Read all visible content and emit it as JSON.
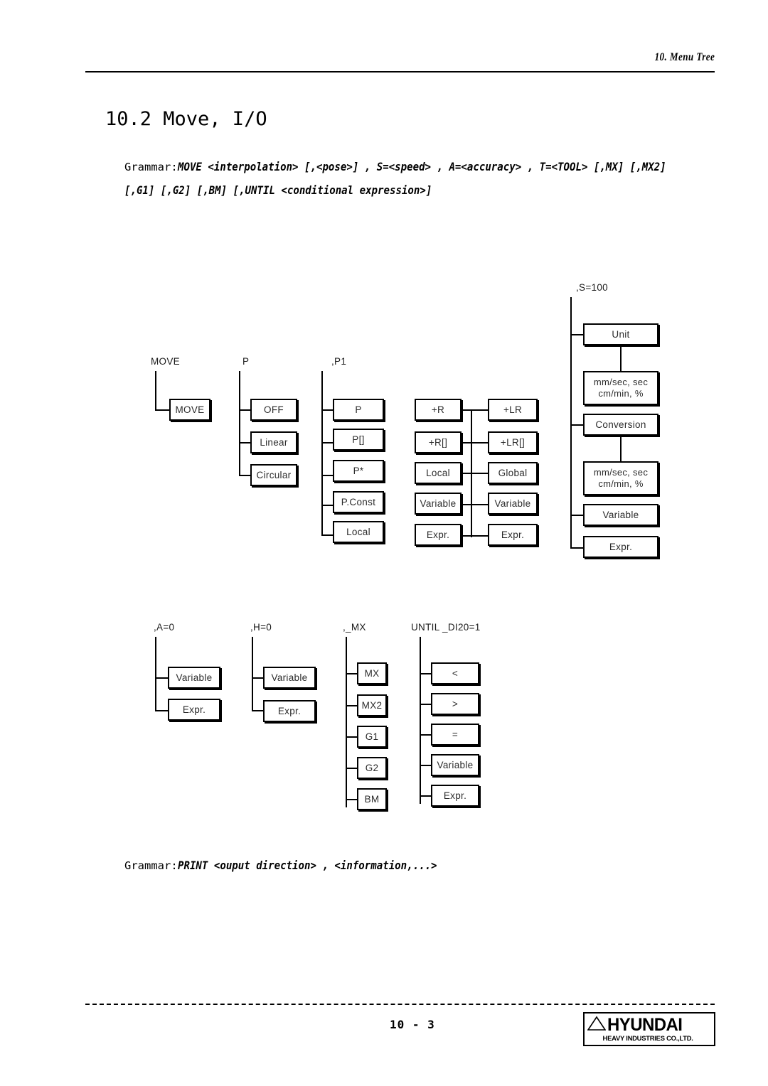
{
  "header": {
    "chapter": "10. Menu Tree"
  },
  "section": {
    "title": "10.2 Move, I/O"
  },
  "grammar_move": {
    "label": "Grammar:",
    "line1": "MOVE <interpolation> [,<pose>] , S=<speed> , A=<accuracy> , T=<TOOL> [,MX] [,MX2]",
    "line2": "[,G1] [,G2] [,BM] [,UNTIL <conditional expression>]"
  },
  "grammar_print": {
    "label": "Grammar:",
    "line1": "PRINT <ouput direction> , <information,...>"
  },
  "tree_upper": {
    "col_move": {
      "label": "MOVE",
      "nodes": [
        "MOVE"
      ]
    },
    "col_interpolation": {
      "label": "P",
      "nodes": [
        "OFF",
        "Linear",
        "Circular"
      ]
    },
    "col_pose": {
      "label": ",P1",
      "nodes": [
        "P",
        "P[]",
        "P*",
        "P.Const",
        "Local"
      ]
    },
    "col_r": {
      "nodes": [
        "+R",
        "+R[]",
        "Local",
        "Variable",
        "Expr."
      ]
    },
    "col_lr": {
      "nodes": [
        "+LR",
        "+LR[]",
        "Global",
        "Variable",
        "Expr."
      ]
    },
    "col_speed": {
      "label": ",S=100",
      "nodes": [
        "Unit",
        "Conversion",
        "Variable",
        "Expr."
      ],
      "unit_sub_line1": "mm/sec, sec",
      "unit_sub_line2": "cm/min, %",
      "conversion_sub_line1": "mm/sec, sec",
      "conversion_sub_line2": "cm/min, %"
    }
  },
  "tree_lower": {
    "col_accuracy": {
      "label": ",A=0",
      "nodes": [
        "Variable",
        "Expr."
      ]
    },
    "col_tool": {
      "label": ",H=0",
      "nodes": [
        "Variable",
        "Expr."
      ]
    },
    "col_mx": {
      "label": ",_MX",
      "nodes": [
        "MX",
        "MX2",
        "G1",
        "G2",
        "BM"
      ]
    },
    "col_until": {
      "label": "UNTIL _DI20=1",
      "nodes": [
        "<",
        ">",
        "=",
        "Variable",
        "Expr."
      ]
    }
  },
  "footer": {
    "page_number": "10 - 3",
    "logo_word": "HYUNDAI",
    "logo_sub": "HEAVY INDUSTRIES CO.,LTD."
  }
}
